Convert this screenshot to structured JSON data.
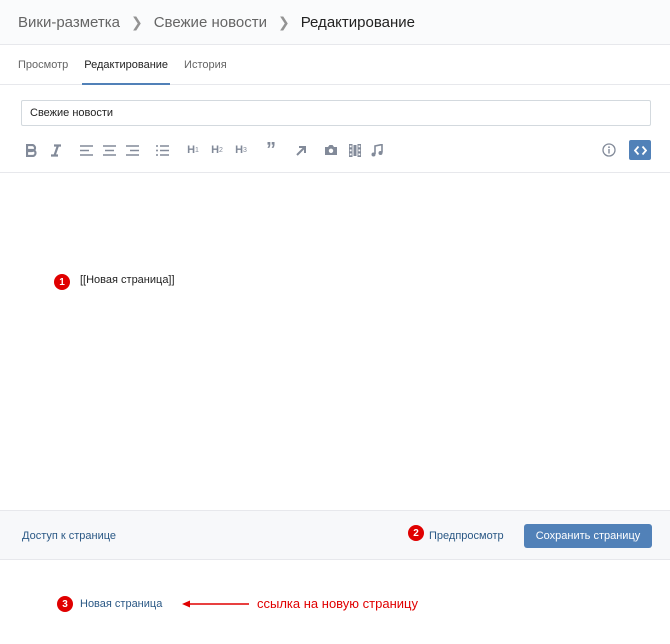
{
  "breadcrumb": {
    "items": [
      "Вики-разметка",
      "Свежие новости",
      "Редактирование"
    ]
  },
  "tabs": [
    {
      "label": "Просмотр",
      "active": false
    },
    {
      "label": "Редактирование",
      "active": true
    },
    {
      "label": "История",
      "active": false
    }
  ],
  "editor": {
    "title_value": "Свежие новости",
    "toolbar": {
      "h1": "H",
      "h1_sub": "1",
      "h2": "H",
      "h2_sub": "2",
      "h3": "H",
      "h3_sub": "3",
      "quote": "”",
      "icons": [
        "bold-icon",
        "italic-icon",
        "align-left-icon",
        "align-center-icon",
        "align-right-icon",
        "list-icon",
        "h1-icon",
        "h2-icon",
        "h3-icon",
        "quote-icon",
        "link-icon",
        "photo-icon",
        "video-icon",
        "audio-icon",
        "info-icon",
        "code-icon"
      ]
    },
    "content": "[[Новая страница]]"
  },
  "annotations": {
    "badge_1": "1",
    "badge_2": "2",
    "badge_3": "3",
    "arrow_label": "ссылка на новую страницу",
    "color": "#e00000"
  },
  "footer": {
    "access_label": "Доступ к странице",
    "preview_label": "Предпросмотр",
    "save_label": "Сохранить страницу"
  },
  "result": {
    "link_text": "Новая страница"
  },
  "colors": {
    "accent": "#5181b8",
    "link": "#2a5885",
    "icon": "#828a99"
  }
}
